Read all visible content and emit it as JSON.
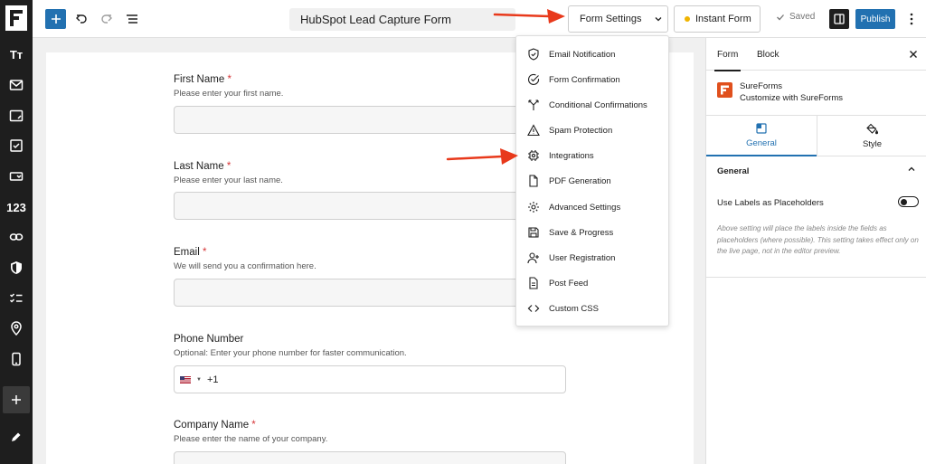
{
  "topbar": {
    "form_title": "HubSpot Lead Capture Form",
    "form_settings_label": "Form Settings",
    "instant_form_label": "Instant Form",
    "saved_label": "Saved",
    "publish_label": "Publish"
  },
  "leftbar": {
    "items": [
      {
        "icon": "text-icon",
        "text": "Tт"
      },
      {
        "icon": "mail-icon"
      },
      {
        "icon": "textarea-icon"
      },
      {
        "icon": "checkbox-icon"
      },
      {
        "icon": "dropdown-icon"
      },
      {
        "icon": "number-icon",
        "text": "123"
      },
      {
        "icon": "link-icon"
      },
      {
        "icon": "shield-icon"
      },
      {
        "icon": "checklist-icon"
      },
      {
        "icon": "location-icon"
      },
      {
        "icon": "phone-icon"
      },
      {
        "icon": "plus-icon"
      },
      {
        "icon": "pencil-icon"
      }
    ]
  },
  "form": {
    "fields": [
      {
        "label": "First Name",
        "required": "*",
        "help": "Please enter your first name."
      },
      {
        "label": "Last Name",
        "required": "*",
        "help": "Please enter your last name."
      },
      {
        "label": "Email",
        "required": "*",
        "help": "We will send you a confirmation here."
      },
      {
        "label": "Phone Number",
        "required": "",
        "help": "Optional: Enter your phone number for faster communication."
      },
      {
        "label": "Company Name",
        "required": "*",
        "help": "Please enter the name of your company."
      }
    ],
    "phone_prefix": "+1"
  },
  "menu": {
    "items": [
      {
        "label": "Email Notification",
        "icon": "shield-check-icon"
      },
      {
        "label": "Form Confirmation",
        "icon": "check-circle-icon"
      },
      {
        "label": "Conditional Confirmations",
        "icon": "branch-icon"
      },
      {
        "label": "Spam Protection",
        "icon": "warning-icon"
      },
      {
        "label": "Integrations",
        "icon": "integration-icon"
      },
      {
        "label": "PDF Generation",
        "icon": "document-icon"
      },
      {
        "label": "Advanced Settings",
        "icon": "gear-icon"
      },
      {
        "label": "Save & Progress",
        "icon": "save-icon"
      },
      {
        "label": "User Registration",
        "icon": "user-plus-icon"
      },
      {
        "label": "Post Feed",
        "icon": "post-icon"
      },
      {
        "label": "Custom CSS",
        "icon": "code-icon"
      }
    ]
  },
  "right_panel": {
    "tabs": [
      "Form",
      "Block"
    ],
    "brand_name": "SureForms",
    "brand_sub": "Customize with SureForms",
    "settings_tabs": [
      "General",
      "Style"
    ],
    "section_title": "General",
    "option_label": "Use Labels as Placeholders",
    "option_help": "Above setting will place the labels inside the fields as placeholders (where possible). This setting takes effect only on the live page, not in the editor preview.",
    "toggle_on": false
  },
  "colors": {
    "accent": "#2271b1",
    "arrow": "#e8391b",
    "required": "#d63638",
    "brand": "#e0501d"
  }
}
